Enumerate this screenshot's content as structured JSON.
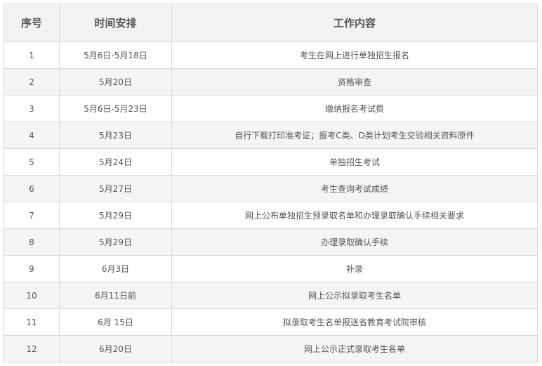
{
  "table": {
    "headers": {
      "index": "序号",
      "time": "时间安排",
      "content": "工作内容"
    },
    "rows": [
      {
        "index": "1",
        "time": "5月6日-5月18日",
        "content": "考生在网上进行单独招生报名"
      },
      {
        "index": "2",
        "time": "5月20日",
        "content": "资格审查"
      },
      {
        "index": "3",
        "time": "5月6日-5月23日",
        "content": "缴纳报名考试费"
      },
      {
        "index": "4",
        "time": "5月23日",
        "content": "自行下载打印准考证；报考C类、D类计划考生交验相关资料原件"
      },
      {
        "index": "5",
        "time": "5月24日",
        "content": "单独招生考试"
      },
      {
        "index": "6",
        "time": "5月27日",
        "content": "考生查询考试成绩"
      },
      {
        "index": "7",
        "time": "5月29日",
        "content": "网上公布单独招生预录取名单和办理录取确认手续相关要求"
      },
      {
        "index": "8",
        "time": "5月29日",
        "content": "办理录取确认手续"
      },
      {
        "index": "9",
        "time": "6月3日",
        "content": "补录"
      },
      {
        "index": "10",
        "time": "6月11日前",
        "content": "网上公示拟录取考生名单"
      },
      {
        "index": "11",
        "time": "6月 15日",
        "content": "拟录取考生名单报送省教育考试院审核"
      },
      {
        "index": "12",
        "time": "6月20日",
        "content": "网上公示正式录取考生名单"
      }
    ]
  }
}
